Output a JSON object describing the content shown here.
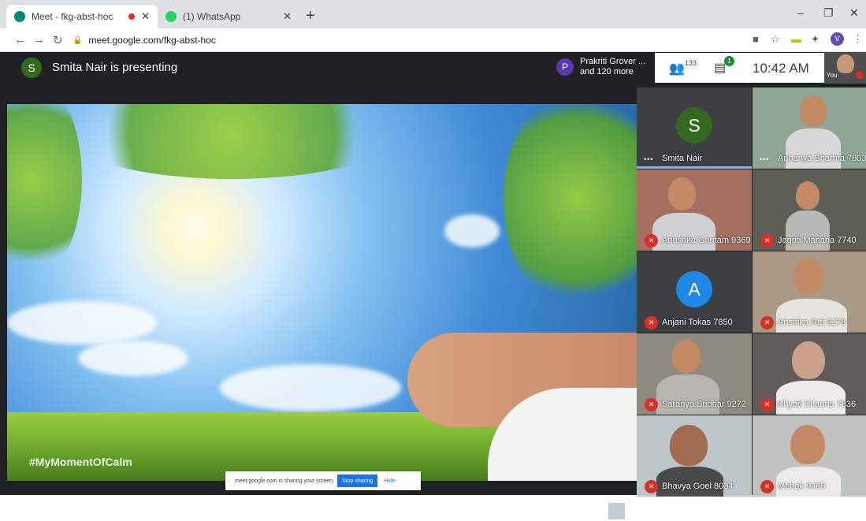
{
  "browser": {
    "tabs": [
      {
        "title": "Meet - fkg-abst-hoc",
        "active": true
      },
      {
        "title": "(1) WhatsApp",
        "active": false
      }
    ],
    "url": "meet.google.com/fkg-abst-hoc",
    "profile_initial": "V"
  },
  "meet": {
    "presenter_initial": "S",
    "presenting_text": "Smita Nair is presenting",
    "people_card": {
      "initial": "P",
      "line1": "Prakriti Grover ...",
      "line2": "and 120 more"
    },
    "people_count": "133",
    "chat_badge": "1",
    "time": "10:42 AM",
    "self_label": "You",
    "stage_caption": "#MyMomentOfCalm",
    "share_banner": {
      "text": "meet.google.com is sharing your screen.",
      "stop_label": "Stop sharing",
      "hide_label": "Hide"
    },
    "participants": [
      {
        "name": "Smita Nair",
        "initial": "S",
        "mic": "dots"
      },
      {
        "name": "Annanya Sharma 7803",
        "mic": "dots"
      },
      {
        "name": "Anushka Gautam 9369",
        "mic": "muted"
      },
      {
        "name": "Jagriti Mahana 7740",
        "mic": "muted"
      },
      {
        "name": "Anjani Tokas 7850",
        "initial": "A",
        "mic": "muted"
      },
      {
        "name": "Anshika Rai 9278",
        "mic": "muted"
      },
      {
        "name": "Saranya Sridhar 9272",
        "mic": "muted"
      },
      {
        "name": "Khyati Khanna 7836",
        "mic": "muted"
      },
      {
        "name": "Bhavya Goel 8034",
        "mic": "muted"
      },
      {
        "name": "Mehak 9405",
        "mic": "muted"
      }
    ]
  }
}
